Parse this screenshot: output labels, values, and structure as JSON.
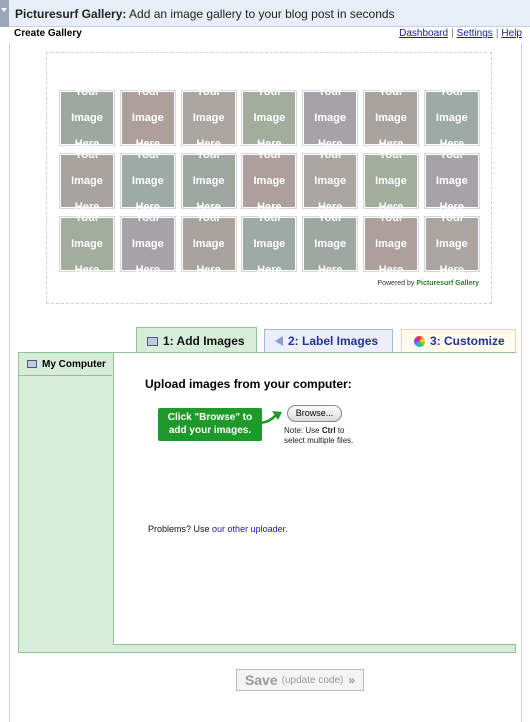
{
  "window": {
    "app_name": "Picturesurf Gallery:",
    "tagline": "Add an image gallery to your blog post in seconds"
  },
  "header": {
    "heading": "Create Gallery",
    "links": [
      "Dashboard",
      "Settings",
      "Help"
    ]
  },
  "preview": {
    "placeholder_line1": "Your",
    "placeholder_line2": "Image",
    "placeholder_line3": "Here",
    "powered_prefix": "Powered by",
    "powered_brand": "Picturesurf Gallery"
  },
  "tabs": [
    {
      "label": "1: Add Images",
      "icon": "monitor-icon",
      "active": true
    },
    {
      "label": "2: Label Images",
      "icon": "tag-icon",
      "active": false
    },
    {
      "label": "3: Customize",
      "icon": "color-wheel-icon",
      "active": false
    }
  ],
  "sidebar": {
    "items": [
      {
        "label": "My Computer",
        "icon": "computer-icon"
      }
    ]
  },
  "upload": {
    "title": "Upload images from your computer:",
    "callout_line1": "Click \"Browse\" to",
    "callout_line2": "add your images.",
    "browse_label": "Browse...",
    "note_prefix": "Note: Use",
    "note_key": "Ctrl",
    "note_suffix": "to",
    "note_line2": "select multiple files.",
    "problems_prefix": "Problems? Use",
    "problems_link": "our other uploader."
  },
  "save": {
    "label": "Save",
    "sub_label": "(update code)",
    "chevron": "»"
  },
  "colors": {
    "tab1_bg": "#d7edd9",
    "tab2_bg": "#eceef9",
    "tab3_bg": "#fffbee",
    "callout_bg": "#1e9a2a",
    "link": "#1a1aa6"
  }
}
